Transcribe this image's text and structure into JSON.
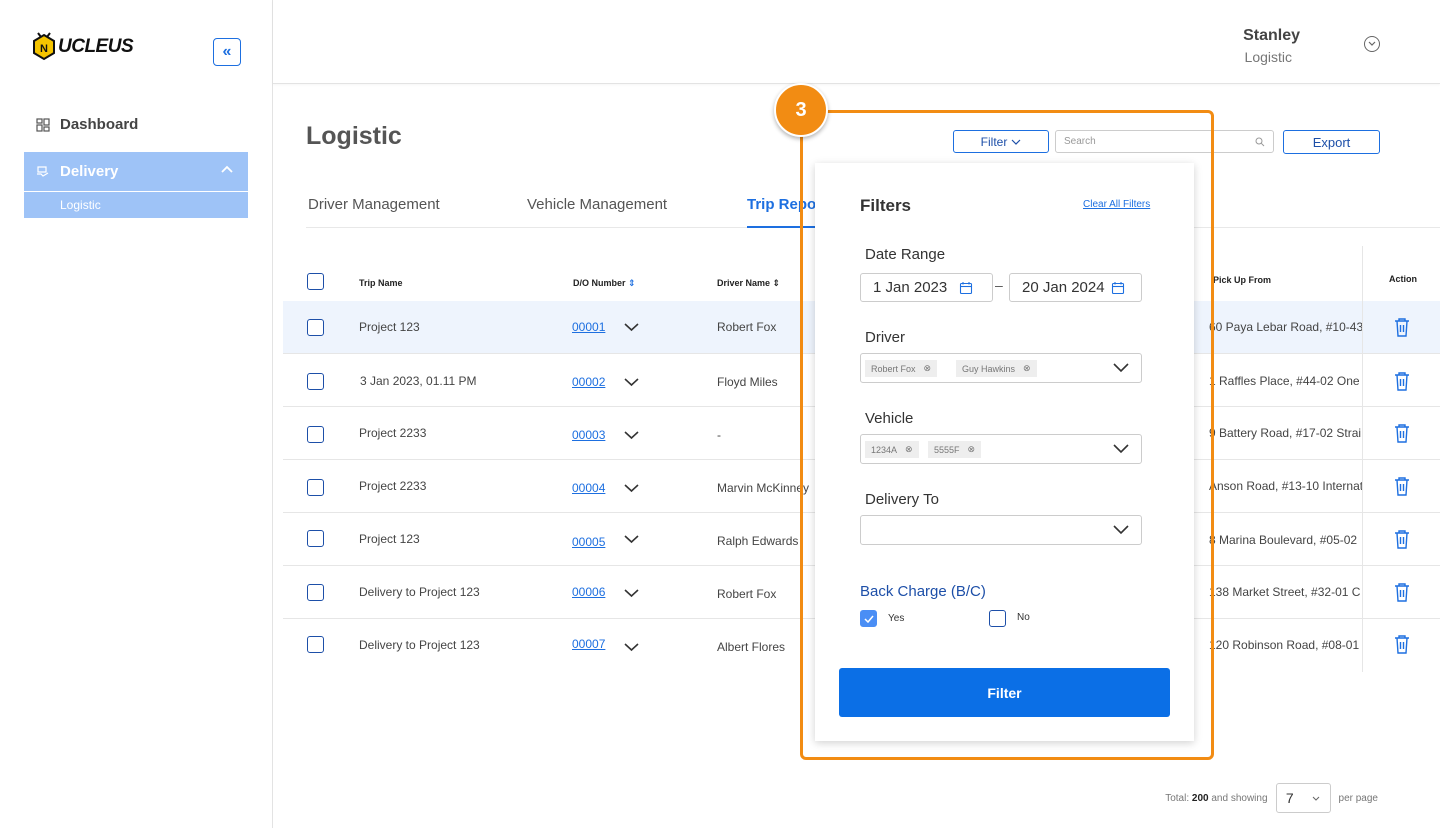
{
  "brand": {
    "logo_letter": "N",
    "logo_text": "UCLEUS"
  },
  "sidebar": {
    "collapse_icon": "«",
    "dashboard_label": "Dashboard",
    "delivery_label": "Delivery",
    "delivery_sub_label": "Logistic"
  },
  "header": {
    "user_name": "Stanley",
    "user_role": "Logistic"
  },
  "page": {
    "title": "Logistic",
    "filter_button": "Filter",
    "search_placeholder": "Search",
    "export_button": "Export"
  },
  "tabs": [
    {
      "label": "Driver Management"
    },
    {
      "label": "Vehicle Management"
    },
    {
      "label": "Trip Repo"
    }
  ],
  "table": {
    "headers": {
      "trip_name": "Trip Name",
      "do_number": "D/O Number",
      "driver_name": "Driver Name",
      "pick_up_from": "Pick Up From",
      "action": "Action"
    },
    "rows": [
      {
        "trip": "Project 123",
        "do": "00001",
        "driver": "Robert Fox",
        "pickup": "60 Paya Lebar Road, #10-43"
      },
      {
        "trip": "3 Jan 2023, 01.11 PM",
        "do": "00002",
        "driver": "Floyd Miles",
        "pickup": "1 Raffles Place, #44-02 One"
      },
      {
        "trip": "Project 2233",
        "do": "00003",
        "driver": "-",
        "pickup": "9 Battery Road, #17-02 Strai"
      },
      {
        "trip": "Project 2233",
        "do": "00004",
        "driver": "Marvin McKinney",
        "pickup": "Anson Road, #13-10 Internat"
      },
      {
        "trip": "Project 123",
        "do": "00005",
        "driver": "Ralph Edwards",
        "pickup": "8 Marina Boulevard, #05-02"
      },
      {
        "trip": "Delivery to Project 123",
        "do": "00006",
        "driver": "Robert Fox",
        "pickup": "138 Market Street, #32-01 C"
      },
      {
        "trip": "Delivery to Project 123",
        "do": "00007",
        "driver": "Albert Flores",
        "pickup": "120 Robinson Road, #08-01"
      }
    ]
  },
  "annotation": {
    "step": "3",
    "color": "#f28c13"
  },
  "filter_panel": {
    "title": "Filters",
    "clear_all": "Clear All Filters",
    "date_range_label": "Date Range",
    "date_from": "1 Jan 2023",
    "date_to": "20 Jan 2024",
    "date_sep": "–",
    "driver_label": "Driver",
    "driver_chips": [
      "Robert Fox",
      "Guy Hawkins"
    ],
    "vehicle_label": "Vehicle",
    "vehicle_chips": [
      "1234A",
      "5555F"
    ],
    "delivery_to_label": "Delivery To",
    "back_charge_label": "Back Charge (B/C)",
    "yes_label": "Yes",
    "no_label": "No",
    "yes_checked": true,
    "no_checked": false,
    "submit": "Filter"
  },
  "footer": {
    "total_prefix": "Total:",
    "total": "200",
    "showing": "and showing",
    "page_size": "7",
    "per_page": "per page"
  },
  "colors": {
    "primary": "#1d6fe0",
    "sidebar_active": "#9ec3f7",
    "button": "#0b6fe6"
  }
}
